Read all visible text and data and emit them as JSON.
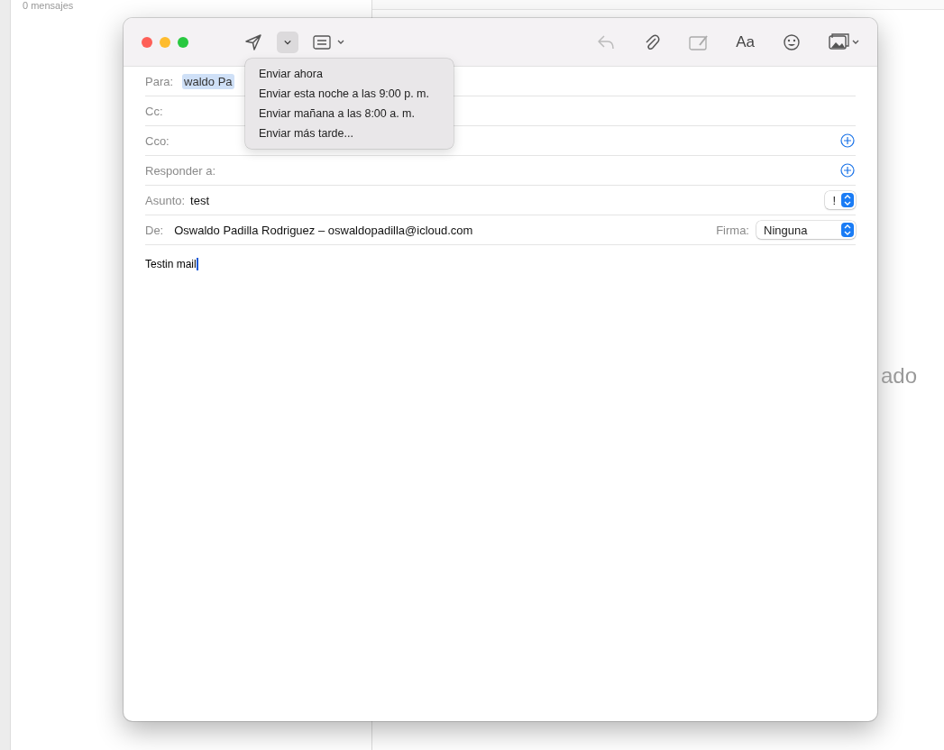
{
  "background": {
    "list_count": "0 mensajes",
    "preview_text": "ado"
  },
  "toolbar": {
    "send_options_expanded": true,
    "reply_disabled": true,
    "font_label": "Aa"
  },
  "send_menu": {
    "items": [
      "Enviar ahora",
      "Enviar esta noche a las 9:00 p. m.",
      "Enviar mañana a las 8:00 a. m.",
      "Enviar más tarde..."
    ]
  },
  "fields": [
    {
      "kind": "recipient",
      "label": "Para:",
      "value": "waldo Pa"
    },
    {
      "kind": "plain",
      "label": "Cc:"
    },
    {
      "kind": "add",
      "label": "Cco:"
    },
    {
      "kind": "add",
      "label": "Responder a:"
    },
    {
      "kind": "subject",
      "label": "Asunto:",
      "value": "test",
      "priority": "!"
    },
    {
      "kind": "from",
      "label": "De:",
      "value": "Oswaldo Padilla Rodriguez – oswaldopadilla@icloud.com",
      "signature_label": "Firma:",
      "signature": "Ninguna"
    }
  ],
  "body": "Testin mail"
}
